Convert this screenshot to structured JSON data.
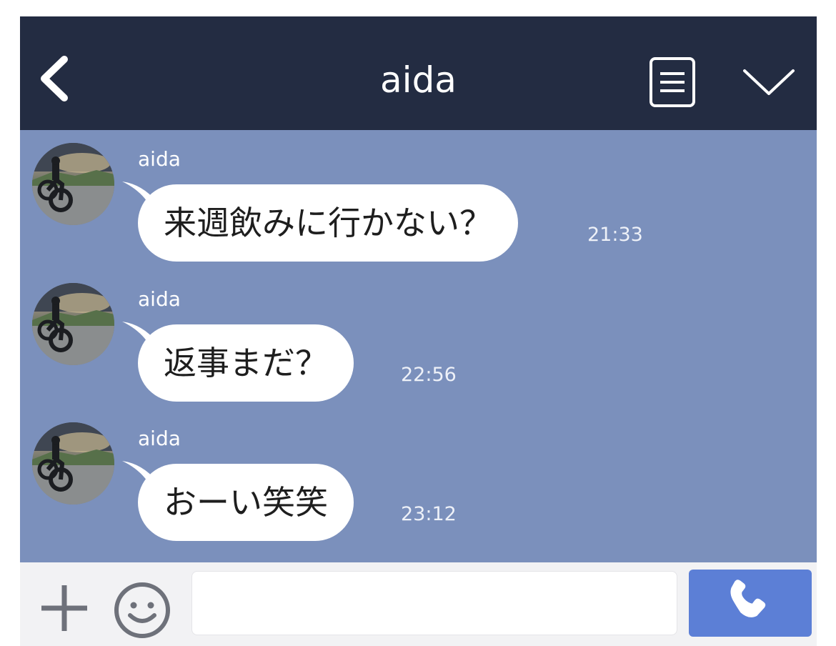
{
  "header": {
    "title": "aida",
    "back_icon": "chevron-left-icon",
    "menu_icon": "list-icon",
    "collapse_icon": "chevron-down-icon"
  },
  "messages": [
    {
      "sender": "aida",
      "text": "来週飲みに行かない？",
      "time": "21:33"
    },
    {
      "sender": "aida",
      "text": "返事まだ？",
      "time": "22:56"
    },
    {
      "sender": "aida",
      "text": "おーい笑笑",
      "time": "23:12"
    }
  ],
  "input": {
    "value": "",
    "placeholder": "",
    "plus_icon": "plus-icon",
    "emoji_icon": "smiley-icon",
    "call_icon": "phone-icon"
  },
  "colors": {
    "header_bg": "#232c42",
    "chat_bg": "#7b90bc",
    "call_button": "#5c7fd6"
  }
}
